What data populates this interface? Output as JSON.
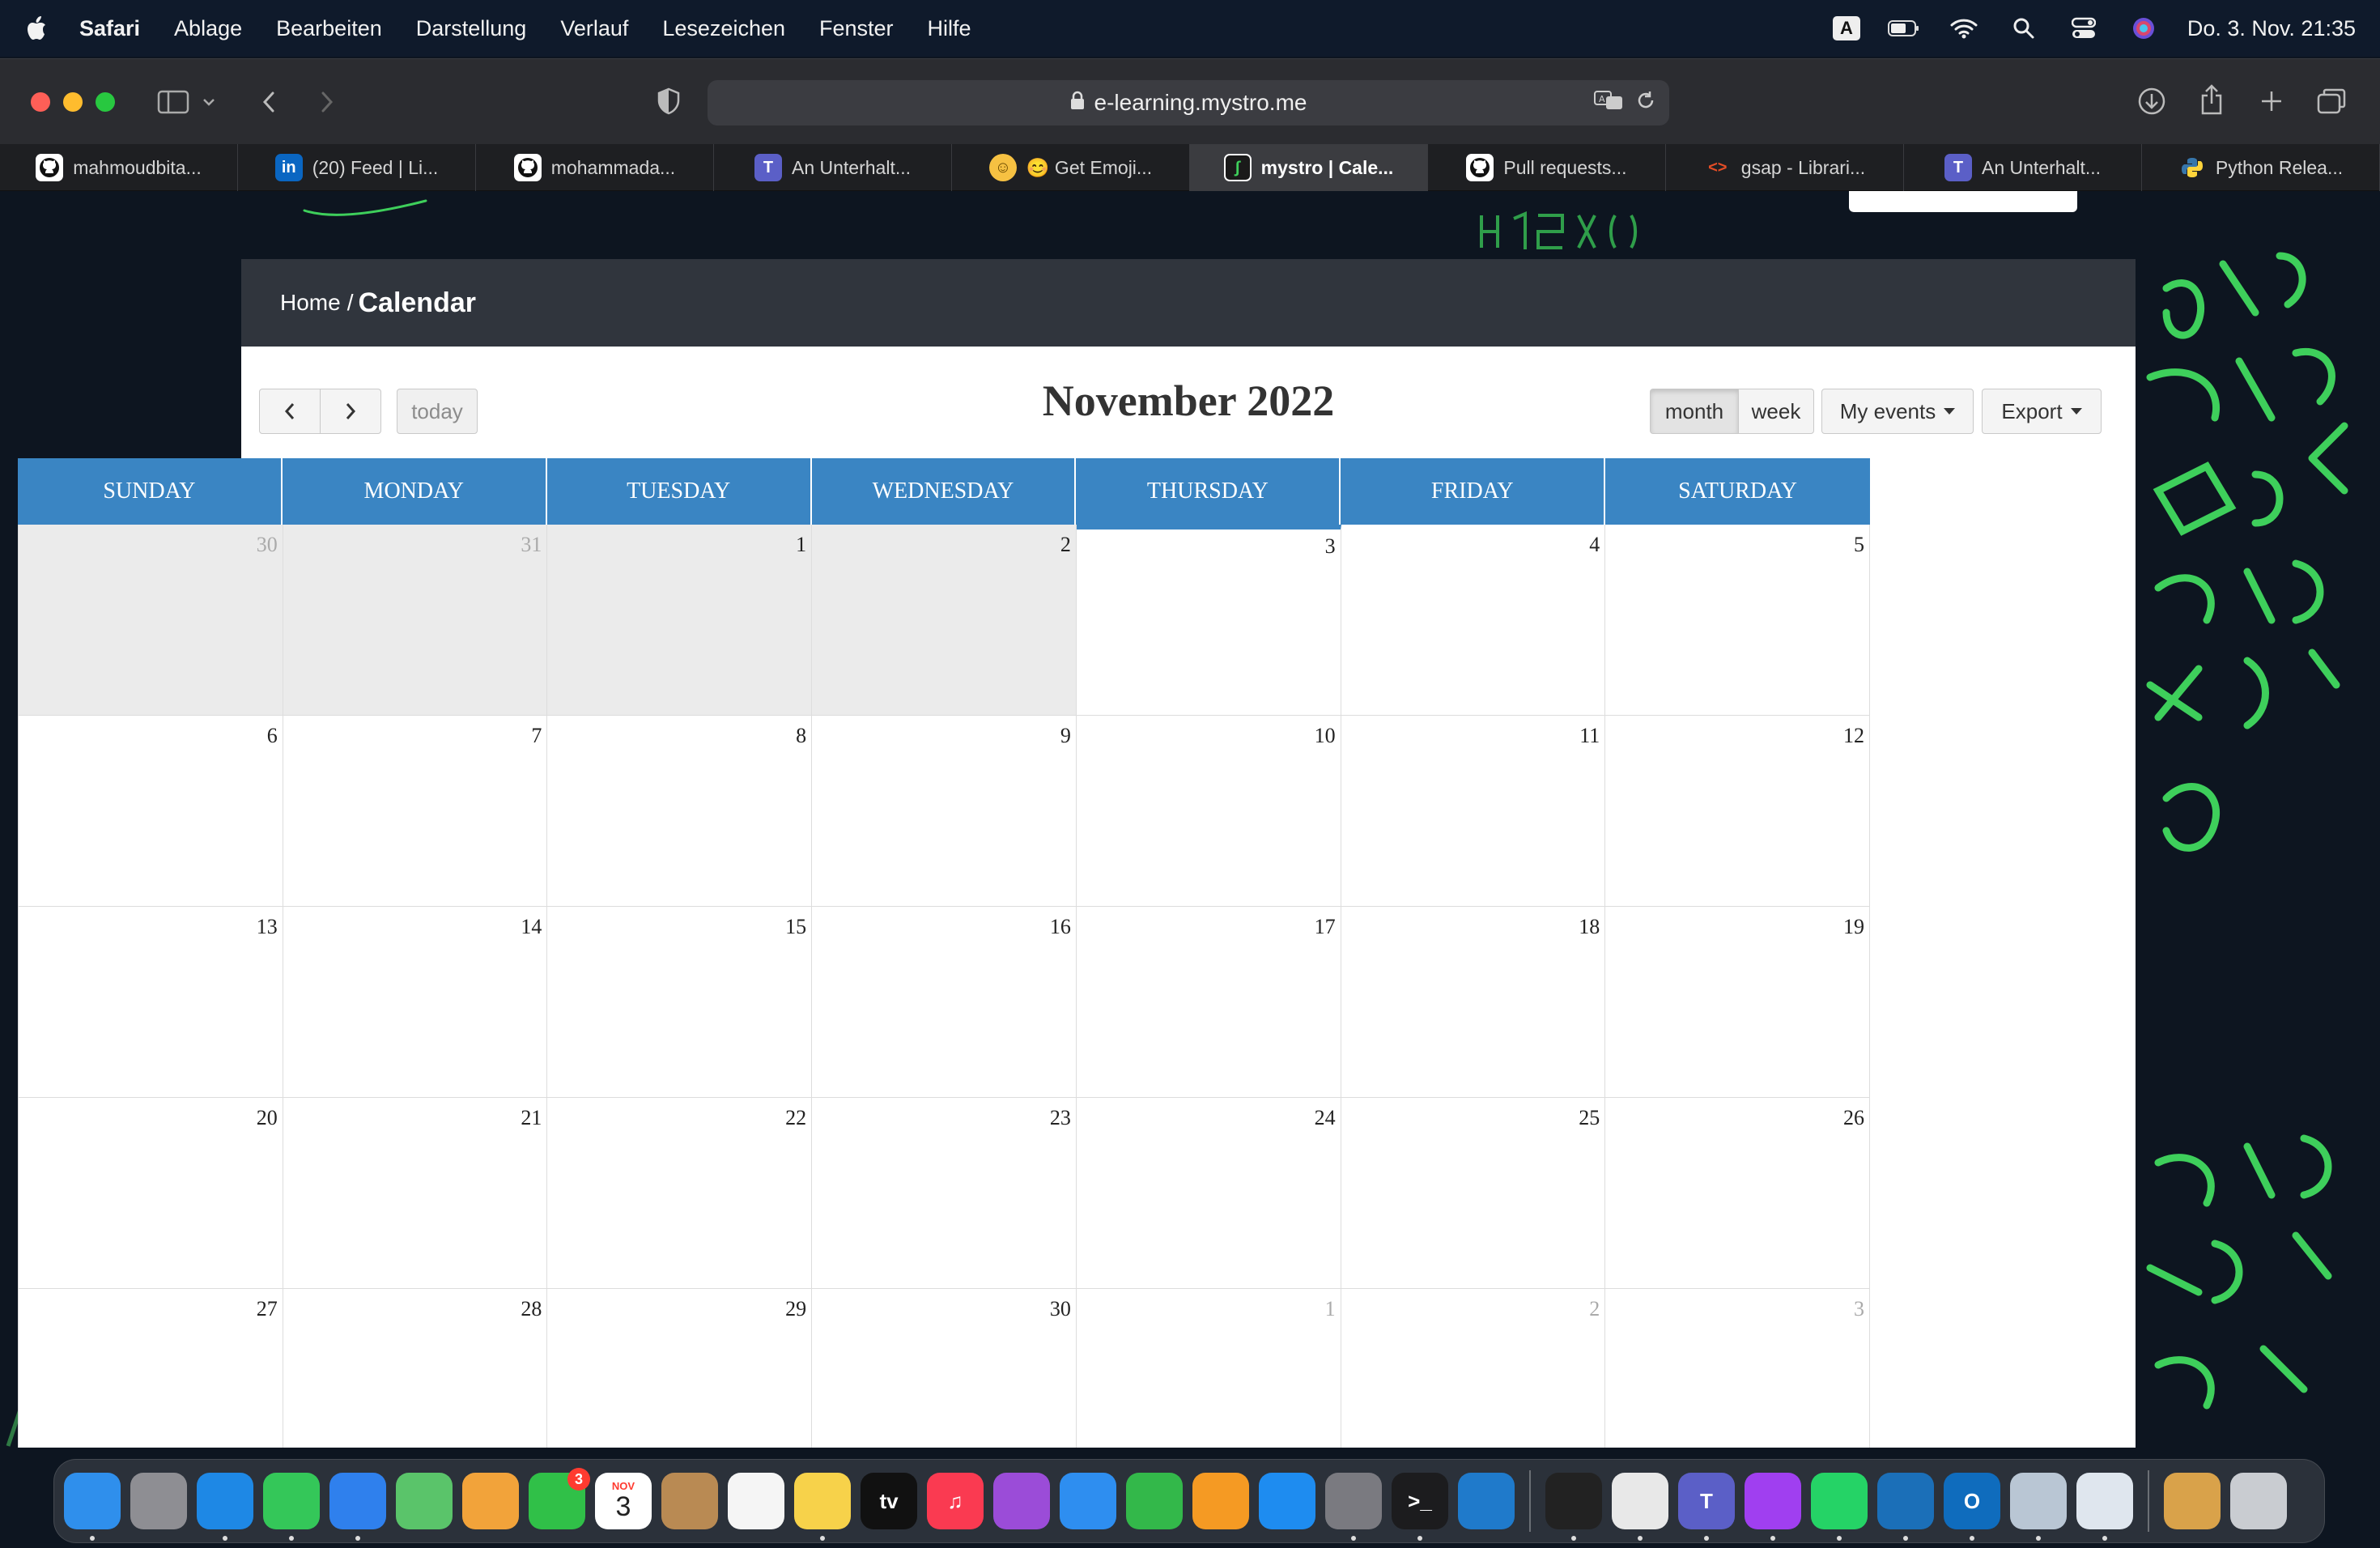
{
  "menubar": {
    "app": "Safari",
    "items": [
      "Ablage",
      "Bearbeiten",
      "Darstellung",
      "Verlauf",
      "Lesezeichen",
      "Fenster",
      "Hilfe"
    ],
    "input_source": "A",
    "datetime": "Do. 3. Nov.  21:35"
  },
  "browser": {
    "url": "e-learning.mystro.me",
    "tabs": [
      {
        "label": "mahmoudbita...",
        "icon": "github-icon",
        "color": "#ffffff"
      },
      {
        "label": "(20) Feed | Li...",
        "icon": "linkedin-icon",
        "color": "#0a66c2"
      },
      {
        "label": "mohammada...",
        "icon": "github-icon",
        "color": "#ffffff"
      },
      {
        "label": "An Unterhalt...",
        "icon": "teams-icon",
        "color": "#5b5fc7"
      },
      {
        "label": "😊 Get Emoji...",
        "icon": "emoji-icon",
        "color": "#f6c142"
      },
      {
        "label": "mystro | Cale...",
        "icon": "mystro-icon",
        "color": "#1a1a1a"
      },
      {
        "label": "Pull requests...",
        "icon": "github-icon",
        "color": "#ffffff"
      },
      {
        "label": "gsap - Librari...",
        "icon": "code-icon",
        "color": "#e44d26"
      },
      {
        "label": "An Unterhalt...",
        "icon": "teams-icon",
        "color": "#5b5fc7"
      },
      {
        "label": "Python Relea...",
        "icon": "python-icon",
        "color": "#3776ab"
      }
    ],
    "active_tab": 5
  },
  "breadcrumb": {
    "home": "Home",
    "separator": "/",
    "current": "Calendar"
  },
  "calendar": {
    "title": "November 2022",
    "today_label": "today",
    "view_month": "month",
    "view_week": "week",
    "my_events": "My events",
    "export": "Export",
    "weekdays": [
      "SUNDAY",
      "MONDAY",
      "TUESDAY",
      "WEDNESDAY",
      "THURSDAY",
      "FRIDAY",
      "SATURDAY"
    ],
    "accent_color": "#3a85c3",
    "days": [
      {
        "n": "30",
        "other": true,
        "past": true
      },
      {
        "n": "31",
        "other": true,
        "past": true
      },
      {
        "n": "1",
        "past": true
      },
      {
        "n": "2",
        "past": true
      },
      {
        "n": "3",
        "today": true
      },
      {
        "n": "4"
      },
      {
        "n": "5"
      },
      {
        "n": "6"
      },
      {
        "n": "7"
      },
      {
        "n": "8"
      },
      {
        "n": "9"
      },
      {
        "n": "10"
      },
      {
        "n": "11"
      },
      {
        "n": "12"
      },
      {
        "n": "13"
      },
      {
        "n": "14"
      },
      {
        "n": "15"
      },
      {
        "n": "16"
      },
      {
        "n": "17"
      },
      {
        "n": "18"
      },
      {
        "n": "19"
      },
      {
        "n": "20"
      },
      {
        "n": "21"
      },
      {
        "n": "22"
      },
      {
        "n": "23"
      },
      {
        "n": "24"
      },
      {
        "n": "25"
      },
      {
        "n": "26"
      },
      {
        "n": "27"
      },
      {
        "n": "28"
      },
      {
        "n": "29"
      },
      {
        "n": "30"
      },
      {
        "n": "1",
        "other": true
      },
      {
        "n": "2",
        "other": true
      },
      {
        "n": "3",
        "other": true
      }
    ]
  },
  "dock": {
    "apps": [
      {
        "name": "finder-icon",
        "label": "",
        "color": "#2f8fec",
        "running": true
      },
      {
        "name": "launchpad-icon",
        "label": "",
        "color": "#8e8e93",
        "running": false
      },
      {
        "name": "safari-icon",
        "label": "",
        "color": "#1e88e5",
        "running": true
      },
      {
        "name": "messages-icon",
        "label": "",
        "color": "#34c759",
        "running": true
      },
      {
        "name": "mail-icon",
        "label": "",
        "color": "#2f80ed",
        "running": true
      },
      {
        "name": "maps-icon",
        "label": "",
        "color": "#5ac46a",
        "running": false
      },
      {
        "name": "photos-icon",
        "label": "",
        "color": "#f2a33a",
        "running": false
      },
      {
        "name": "facetime-icon",
        "label": "",
        "color": "#30c048",
        "running": false,
        "badge": "3"
      },
      {
        "name": "calendar-icon",
        "label": "3",
        "color": "#ffffff",
        "running": false,
        "month": "NOV"
      },
      {
        "name": "contacts-icon",
        "label": "",
        "color": "#b98a53",
        "running": false
      },
      {
        "name": "reminders-icon",
        "label": "",
        "color": "#f5f5f5",
        "running": false
      },
      {
        "name": "notes-icon",
        "label": "",
        "color": "#f7d24a",
        "running": true
      },
      {
        "name": "appletv-icon",
        "label": "tv",
        "color": "#111111",
        "running": false
      },
      {
        "name": "music-icon",
        "label": "♫",
        "color": "#fa3a51",
        "running": false
      },
      {
        "name": "podcasts-icon",
        "label": "",
        "color": "#9b4cd8",
        "running": false
      },
      {
        "name": "keynote-icon",
        "label": "",
        "color": "#2e8ef0",
        "running": false
      },
      {
        "name": "numbers-icon",
        "label": "",
        "color": "#33b84a",
        "running": false
      },
      {
        "name": "pages-icon",
        "label": "",
        "color": "#f59a23",
        "running": false
      },
      {
        "name": "appstore-icon",
        "label": "",
        "color": "#1e8cf0",
        "running": false
      },
      {
        "name": "system-preferences-icon",
        "label": "",
        "color": "#7a7a80",
        "running": true
      },
      {
        "name": "terminal-icon",
        "label": ">_",
        "color": "#1c1c1e",
        "running": true
      },
      {
        "name": "vscode-icon",
        "label": "",
        "color": "#1f7acb",
        "running": false
      },
      {
        "name": "activity-monitor-icon",
        "label": "",
        "color": "#222222",
        "running": true
      },
      {
        "name": "chrome-icon",
        "label": "",
        "color": "#e8e8e8",
        "running": true
      },
      {
        "name": "teams-icon",
        "label": "T",
        "color": "#5b5fc7",
        "running": true
      },
      {
        "name": "messenger-icon",
        "label": "",
        "color": "#a03ff0",
        "running": true
      },
      {
        "name": "whatsapp-icon",
        "label": "",
        "color": "#25d366",
        "running": true
      },
      {
        "name": "vscode-insiders-icon",
        "label": "",
        "color": "#1b6fb8",
        "running": true
      },
      {
        "name": "outlook-icon",
        "label": "O",
        "color": "#0f6cbd",
        "running": true
      },
      {
        "name": "downloads-icon",
        "label": "",
        "color": "#b9c6d4",
        "running": true
      },
      {
        "name": "preview-icon",
        "label": "",
        "color": "#dfe6ee",
        "running": true
      },
      {
        "name": "archive-icon",
        "label": "",
        "color": "#d9a24a",
        "running": false
      },
      {
        "name": "trash-icon",
        "label": "",
        "color": "#c9ccd1",
        "running": false
      }
    ]
  }
}
